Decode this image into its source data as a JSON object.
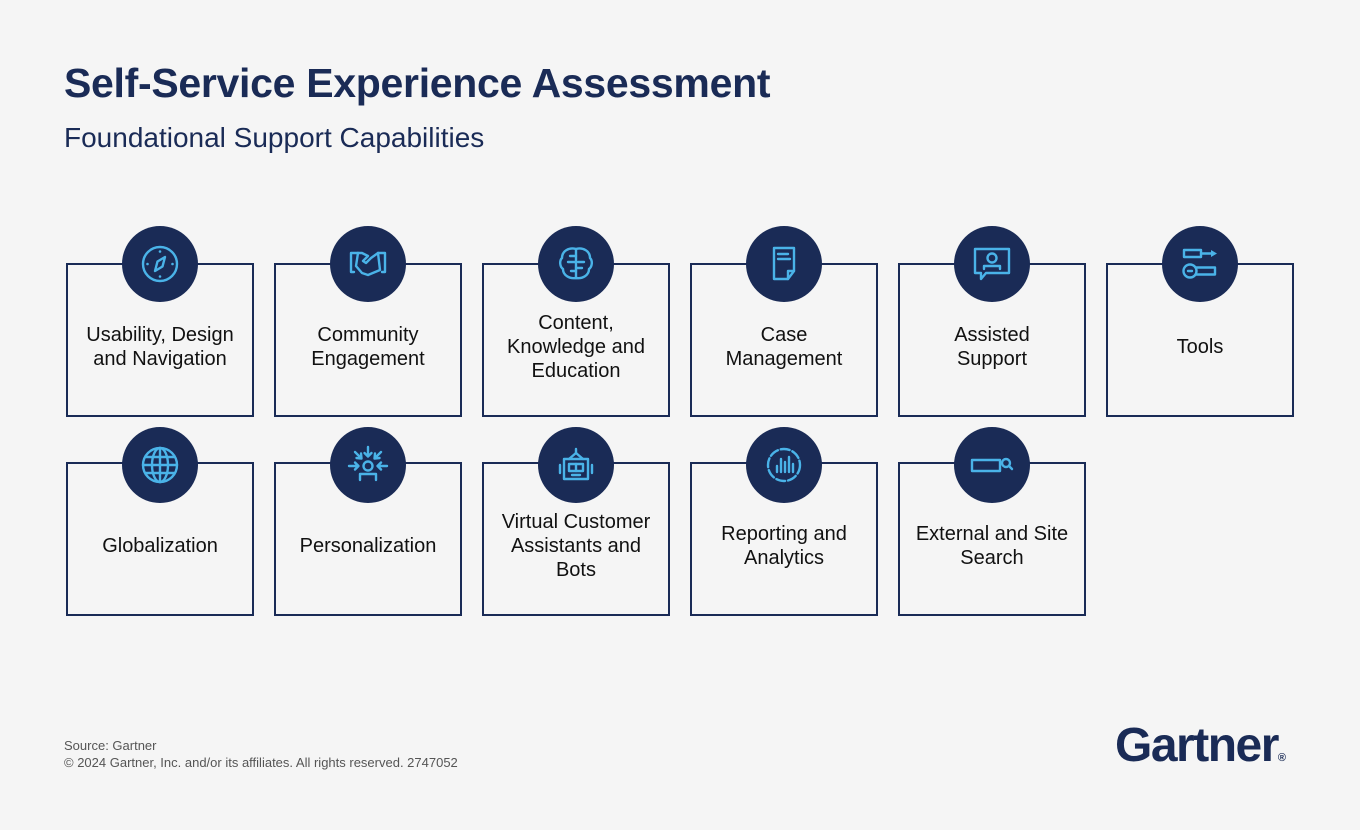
{
  "header": {
    "title": "Self-Service Experience Assessment",
    "subtitle": "Foundational Support Capabilities"
  },
  "capabilities": [
    {
      "label": "Usability, Design\nand Navigation",
      "icon": "compass-icon"
    },
    {
      "label": "Community\nEngagement",
      "icon": "handshake-icon"
    },
    {
      "label": "Content,\nKnowledge and\nEducation",
      "icon": "brain-icon"
    },
    {
      "label": "Case\nManagement",
      "icon": "document-icon"
    },
    {
      "label": "Assisted\nSupport",
      "icon": "chat-person-icon"
    },
    {
      "label": "Tools",
      "icon": "tools-icon"
    },
    {
      "label": "Globalization",
      "icon": "globe-icon"
    },
    {
      "label": "Personalization",
      "icon": "person-focus-icon"
    },
    {
      "label": "Virtual Customer\nAssistants and\nBots",
      "icon": "robot-icon"
    },
    {
      "label": "Reporting and\nAnalytics",
      "icon": "analytics-icon"
    },
    {
      "label": "External and Site\nSearch",
      "icon": "search-bar-icon"
    }
  ],
  "footer": {
    "source": "Source: Gartner",
    "copyright": "© 2024 Gartner, Inc. and/or its affiliates. All rights reserved. 2747052"
  },
  "logo": {
    "text": "Gartner",
    "mark": "®"
  },
  "colors": {
    "navy": "#1a2b56",
    "accent": "#4ab3e8",
    "background": "#f5f5f5"
  }
}
